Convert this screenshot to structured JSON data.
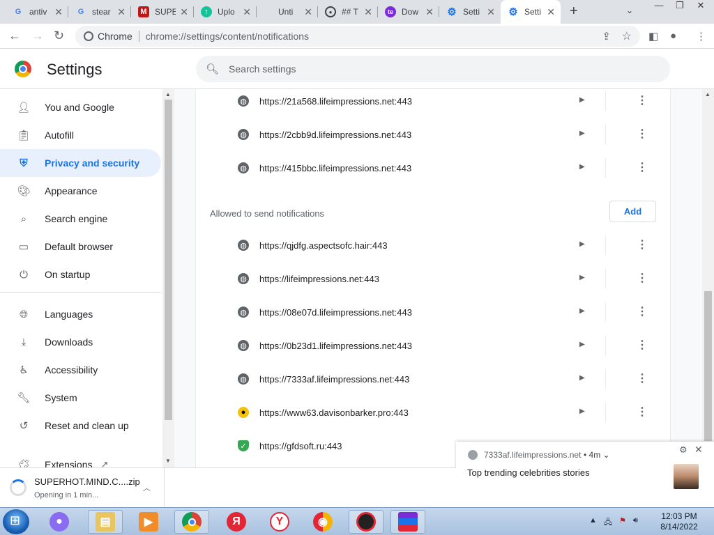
{
  "tabs": [
    {
      "title": "antiv",
      "favicon": "google-icon",
      "color": "#4285f4"
    },
    {
      "title": "stear",
      "favicon": "google-icon",
      "color": "#4285f4"
    },
    {
      "title": "SUPE",
      "favicon": "mcafee-icon",
      "color": "#c01818"
    },
    {
      "title": "Uplo",
      "favicon": "upload-icon",
      "color": "#15c39a"
    },
    {
      "title": "Unti",
      "favicon": "doc-icon",
      "color": "#5f6368"
    },
    {
      "title": "## T",
      "favicon": "github-icon",
      "color": "#3c4043"
    },
    {
      "title": "Dow",
      "favicon": "te-icon",
      "color": "#7b2bd8"
    },
    {
      "title": "Setti",
      "favicon": "gear-icon",
      "color": "#1a73e8"
    },
    {
      "title": "Setti",
      "favicon": "gear-icon",
      "color": "#1a73e8"
    }
  ],
  "omnibox": {
    "chip": "Chrome",
    "url": "chrome://settings/content/notifications"
  },
  "header": {
    "title": "Settings",
    "search_placeholder": "Search settings"
  },
  "sidebar": {
    "items": [
      {
        "label": "You and Google",
        "icon": "person-icon"
      },
      {
        "label": "Autofill",
        "icon": "clipboard-icon"
      },
      {
        "label": "Privacy and security",
        "icon": "shield-icon",
        "active": true
      },
      {
        "label": "Appearance",
        "icon": "palette-icon"
      },
      {
        "label": "Search engine",
        "icon": "search-icon"
      },
      {
        "label": "Default browser",
        "icon": "browser-icon"
      },
      {
        "label": "On startup",
        "icon": "power-icon"
      },
      {
        "label": "Languages",
        "icon": "globe-icon"
      },
      {
        "label": "Downloads",
        "icon": "download-icon"
      },
      {
        "label": "Accessibility",
        "icon": "accessibility-icon"
      },
      {
        "label": "System",
        "icon": "wrench-icon"
      },
      {
        "label": "Reset and clean up",
        "icon": "history-icon"
      },
      {
        "label": "Extensions",
        "icon": "puzzle-icon"
      }
    ]
  },
  "content": {
    "blocked_sites": [
      "https://21a568.lifeimpressions.net:443",
      "https://2cbb9d.lifeimpressions.net:443",
      "https://415bbc.lifeimpressions.net:443"
    ],
    "allowed_label": "Allowed to send notifications",
    "add_label": "Add",
    "allowed_sites": [
      {
        "url": "https://qjdfg.aspectsofc.hair:443",
        "icon": "globe"
      },
      {
        "url": "https://lifeimpressions.net:443",
        "icon": "globe"
      },
      {
        "url": "https://08e07d.lifeimpressions.net:443",
        "icon": "globe"
      },
      {
        "url": "https://0b23d1.lifeimpressions.net:443",
        "icon": "globe"
      },
      {
        "url": "https://7333af.lifeimpressions.net:443",
        "icon": "globe"
      },
      {
        "url": "https://www63.davisonbarker.pro:443",
        "icon": "bee"
      },
      {
        "url": "https://gfdsoft.ru:443",
        "icon": "shield"
      }
    ]
  },
  "notification": {
    "origin": "7333af.lifeimpressions.net",
    "age": "• 4m ⌄",
    "message": "Top trending celebrities stories"
  },
  "download": {
    "filename": "SUPERHOT.MIND.C....zip",
    "status": "Opening in 1 min..."
  },
  "taskbar": {
    "time": "12:03 PM",
    "date": "8/14/2022"
  }
}
